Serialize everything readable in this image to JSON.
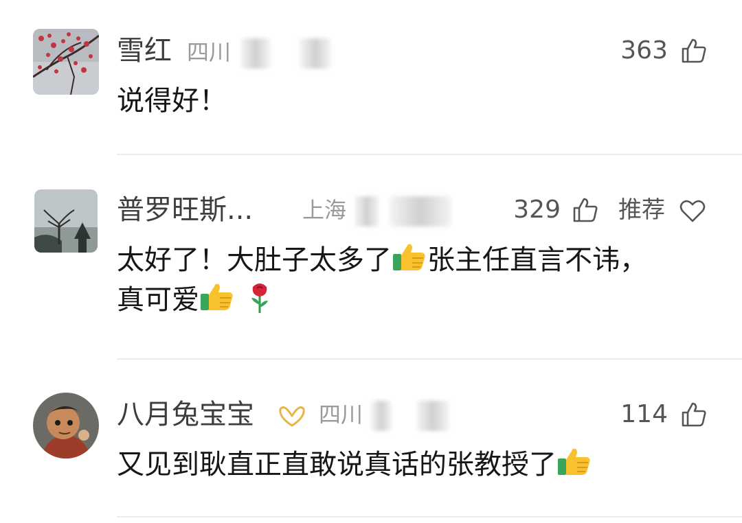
{
  "comments": [
    {
      "name": "雪红",
      "region": "四川",
      "likes": "363",
      "text": "说得好！",
      "avatar": "plum-blossom-avatar"
    },
    {
      "name": "普罗旺斯...",
      "region": "上海",
      "likes": "329",
      "recommend_label": "推荐",
      "text_part1": "太好了！大肚子太多了",
      "text_part2": "张主任直言不讳，",
      "text_part3": "真可爱",
      "avatar": "lakeside-tree-avatar"
    },
    {
      "name": "八月兔宝宝",
      "region": "四川",
      "likes": "114",
      "text": "又见到耿直正直敢说真话的张教授了",
      "avatar": "cartoon-character-avatar",
      "badge": "vip-badge-icon"
    }
  ],
  "icons": {
    "like": "thumbs-up-outline-icon",
    "heart": "heart-outline-icon",
    "thumbs_emoji": "thumbs-up-emoji",
    "rose_emoji": "rose-emoji"
  },
  "colors": {
    "name": "#3d3d3d",
    "region": "#9a9a9a",
    "badge": "#e6b54a"
  }
}
